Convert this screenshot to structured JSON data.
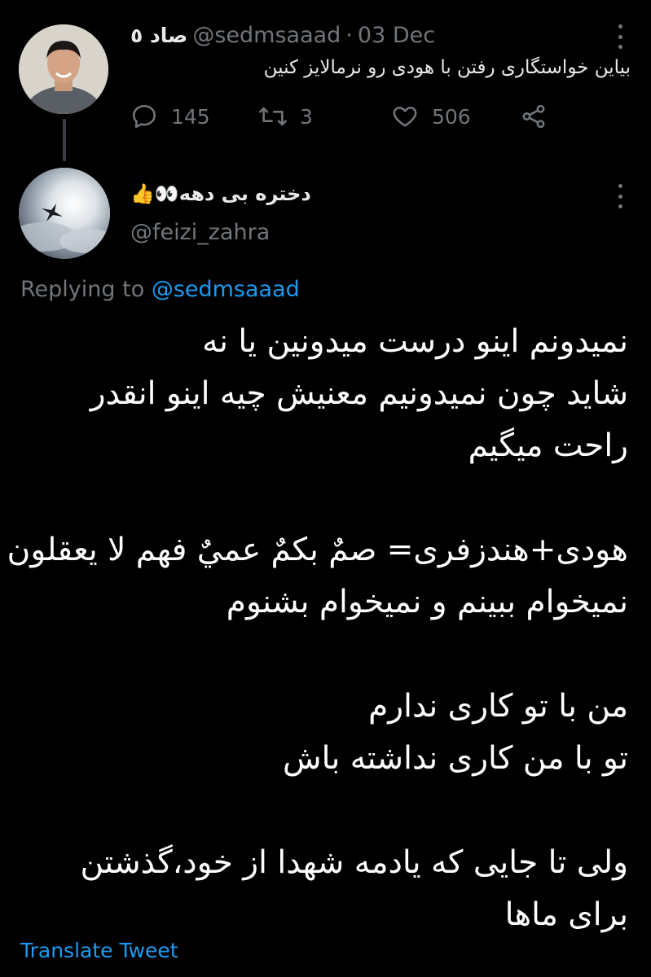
{
  "original_tweet": {
    "display_name": "صاد ٥",
    "handle": "@sedmsaaad",
    "separator": "·",
    "date": "03 Dec",
    "text": "بیاین خواستگاری رفتن با هودی رو نرمالایز کنین",
    "actions": {
      "reply_count": "145",
      "retweet_count": "3",
      "like_count": "506"
    }
  },
  "reply_tweet": {
    "display_name": "دختره بی دهه👀👍",
    "handle": "@feizi_zahra",
    "replying_prefix": "Replying to",
    "replying_to": "@sedmsaaad",
    "lines": [
      "نمیدونم اینو درست میدونین یا نه",
      "شاید چون نمیدونیم معنیش چیه اینو انقدر",
      "راحت میگیم",
      "",
      "هودی+هندزفری= صمٌ بکمٌ عميٌ فهم لا یعقلون",
      "نمیخوام ببینم و نمیخوام بشنوم",
      "",
      "من با تو کاری ندارم",
      "تو با من کاری نداشته باش",
      "",
      "ولی تا جایی که یادمه شهدا از خود،گذشتن",
      "برای ماها"
    ],
    "translate_label": "Translate Tweet"
  },
  "colors": {
    "background": "#000000",
    "text": "#e7e9ea",
    "secondary": "#71767b",
    "link": "#1d9bf0"
  }
}
